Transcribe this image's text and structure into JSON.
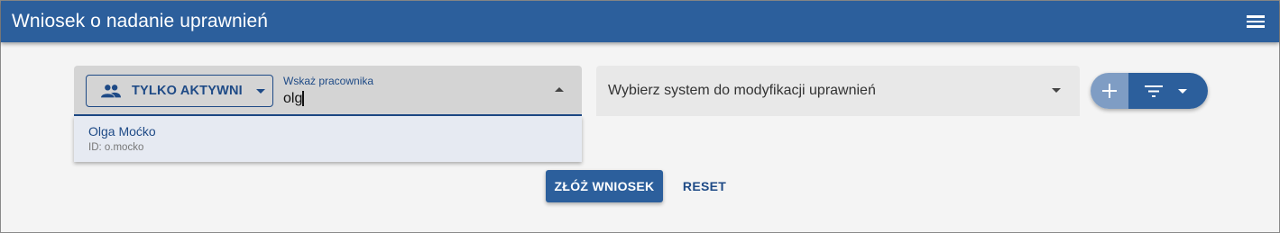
{
  "app": {
    "title": "Wniosek o nadanie uprawnień",
    "menu_icon": "hamburger-menu-icon"
  },
  "employee": {
    "filter_label": "TYLKO AKTYWNI",
    "filter_icon": "people-icon",
    "field_label": "Wskaż pracownika",
    "value": "olg",
    "options": [
      {
        "name": "Olga Moćko",
        "id": "ID: o.mocko"
      }
    ]
  },
  "system": {
    "placeholder": "Wybierz system do modyfikacji uprawnień"
  },
  "actions": {
    "add_icon": "plus-icon",
    "filter_icon": "filter-list-icon",
    "submit_label": "ZŁÓŻ WNIOSEK",
    "reset_label": "RESET"
  },
  "colors": {
    "primary": "#2c5f9c",
    "primary_dark": "#1e4a86",
    "background": "#f4f4f4",
    "option_bg": "#e6eaf2"
  }
}
